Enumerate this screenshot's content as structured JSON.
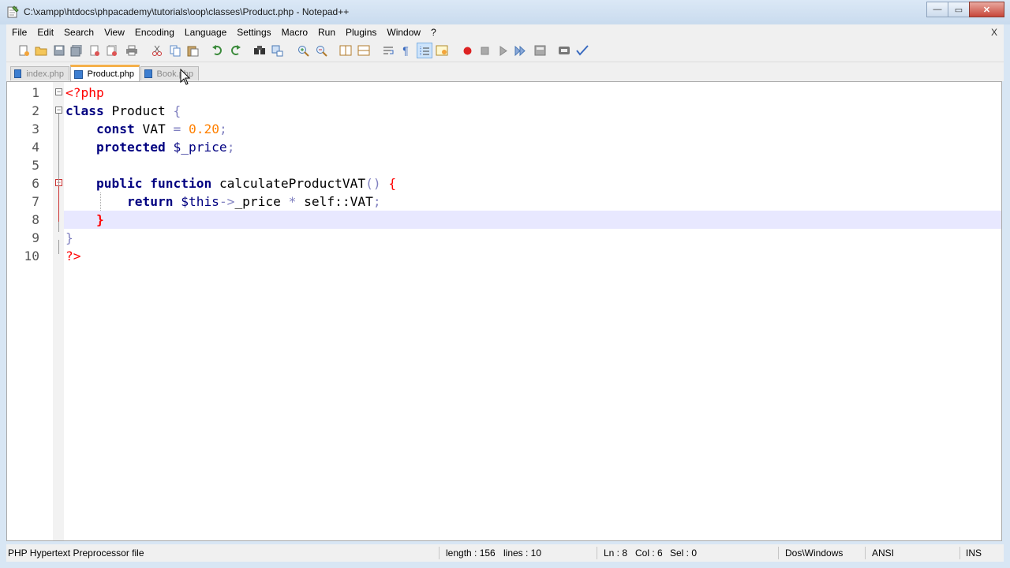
{
  "window": {
    "title": "C:\\xampp\\htdocs\\phpacademy\\tutorials\\oop\\classes\\Product.php - Notepad++",
    "buttons": {
      "minimize": "—",
      "maximize": "▭",
      "close": "✕"
    }
  },
  "menu": {
    "items": [
      "File",
      "Edit",
      "Search",
      "View",
      "Encoding",
      "Language",
      "Settings",
      "Macro",
      "Run",
      "Plugins",
      "Window",
      "?"
    ],
    "close_label": "X"
  },
  "toolbar": {
    "icons": [
      "new-file-icon",
      "open-file-icon",
      "save-icon",
      "save-all-icon",
      "close-icon",
      "close-all-icon",
      "print-icon",
      "cut-icon",
      "copy-icon",
      "paste-icon",
      "undo-icon",
      "redo-icon",
      "find-icon",
      "replace-icon",
      "zoom-in-icon",
      "zoom-out-icon",
      "sync-vertical-icon",
      "sync-horizontal-icon",
      "word-wrap-icon",
      "show-all-characters-icon",
      "indent-guide-icon",
      "user-defined-language-icon",
      "record-macro-icon",
      "stop-macro-icon",
      "play-macro-icon",
      "run-macro-multiple-icon",
      "save-macro-icon",
      "document-map-icon",
      "spellcheck-icon"
    ]
  },
  "tabs": [
    {
      "label": "index.php",
      "active": false
    },
    {
      "label": "Product.php",
      "active": true
    },
    {
      "label": "Book.php",
      "active": false
    }
  ],
  "editor": {
    "lines": [
      {
        "n": "1"
      },
      {
        "n": "2"
      },
      {
        "n": "3"
      },
      {
        "n": "4"
      },
      {
        "n": "5"
      },
      {
        "n": "6"
      },
      {
        "n": "7"
      },
      {
        "n": "8"
      },
      {
        "n": "9"
      },
      {
        "n": "10"
      }
    ],
    "tokens": {
      "open_tag": "<?php",
      "class_kw": "class",
      "class_name": "Product",
      "lbrace": "{",
      "const_kw": "const",
      "const_name": "VAT",
      "eq": "=",
      "const_val": "0.20",
      "semi": ";",
      "protected_kw": "protected",
      "prop": "$_price",
      "public_kw": "public",
      "function_kw": "function",
      "method_name": "calculateProductVAT",
      "parens": "()",
      "return_kw": "return",
      "this_var": "$this",
      "arrow": "->",
      "prop_ref": "_price",
      "mult": "*",
      "self_ref": "self::VAT",
      "rbrace": "}",
      "close_tag": "?>"
    }
  },
  "status": {
    "file_type": "PHP Hypertext Preprocessor file",
    "length": "length : 156",
    "lines": "lines : 10",
    "ln": "Ln : 8",
    "col": "Col : 6",
    "sel": "Sel : 0",
    "eol": "Dos\\Windows",
    "encoding": "ANSI",
    "mode": "INS"
  }
}
